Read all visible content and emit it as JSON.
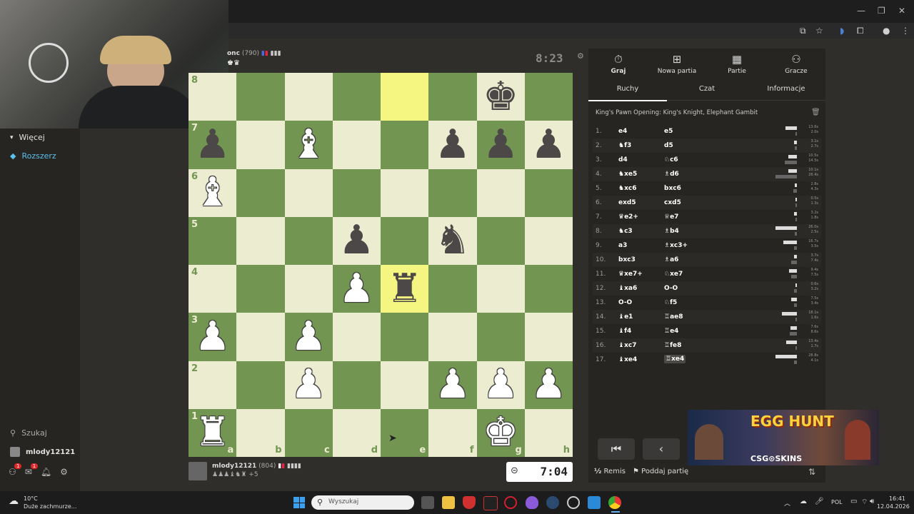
{
  "sidebar": {
    "more_label": "Więcej",
    "extend_label": "Rozszerz",
    "search_label": "Szukaj",
    "username": "mlody12121",
    "notif_badge_1": "1",
    "notif_badge_2": "1"
  },
  "opponent": {
    "name": "onc",
    "rating": "(790)",
    "clock": "8:23"
  },
  "player": {
    "name": "mlody12121",
    "rating": "(804)",
    "captured_advantage": "+5",
    "clock": "7:04"
  },
  "board": {
    "ranks": [
      "8",
      "7",
      "6",
      "5",
      "4",
      "3",
      "2",
      "1"
    ],
    "files": [
      "a",
      "b",
      "c",
      "d",
      "e",
      "f",
      "g",
      "h"
    ],
    "pieces": [
      [
        "",
        "",
        "",
        "",
        "",
        "",
        "♚",
        ""
      ],
      [
        "♟",
        "",
        "♝",
        "",
        "",
        "♟",
        "♟",
        "♟"
      ],
      [
        "♝",
        "",
        "",
        "",
        "",
        "",
        "",
        ""
      ],
      [
        "",
        "",
        "",
        "♟",
        "",
        "♞",
        "",
        ""
      ],
      [
        "",
        "",
        "",
        "♟",
        "♜",
        "",
        "",
        ""
      ],
      [
        "♟",
        "",
        "♟",
        "",
        "",
        "",
        "",
        ""
      ],
      [
        "",
        "",
        "♟",
        "",
        "",
        "♟",
        "♟",
        "♟"
      ],
      [
        "♜",
        "",
        "",
        "",
        "",
        "",
        "♚",
        ""
      ]
    ],
    "colors": [
      [
        "",
        "",
        "",
        "",
        "",
        "",
        "b",
        ""
      ],
      [
        "b",
        "",
        "w",
        "",
        "",
        "b",
        "b",
        "b"
      ],
      [
        "w",
        "",
        "",
        "",
        "",
        "",
        "",
        ""
      ],
      [
        "",
        "",
        "",
        "b",
        "",
        "b",
        "",
        ""
      ],
      [
        "",
        "",
        "",
        "w",
        "b",
        "",
        "",
        ""
      ],
      [
        "w",
        "",
        "w",
        "",
        "",
        "",
        "",
        ""
      ],
      [
        "",
        "",
        "w",
        "",
        "",
        "w",
        "w",
        "w"
      ],
      [
        "w",
        "",
        "",
        "",
        "",
        "",
        "w",
        ""
      ]
    ],
    "highlight": [
      [
        0,
        4
      ],
      [
        4,
        4
      ]
    ]
  },
  "nav_tabs": [
    {
      "label": "Graj",
      "icon": "clock-icon"
    },
    {
      "label": "Nowa partia",
      "icon": "plus-icon"
    },
    {
      "label": "Partie",
      "icon": "board-icon"
    },
    {
      "label": "Gracze",
      "icon": "players-icon"
    }
  ],
  "sub_tabs": [
    "Ruchy",
    "Czat",
    "Informacje"
  ],
  "opening": "King's Pawn Opening: King's Knight, Elephant Gambit",
  "moves": [
    {
      "n": "1.",
      "w": "e4",
      "b": "e5",
      "tw": "13.6s",
      "tb": "2.0s",
      "bw": 0.52,
      "bb": 0.08
    },
    {
      "n": "2.",
      "w": "♞f3",
      "b": "d5",
      "tw": "3.1s",
      "tb": "2.7s",
      "bw": 0.12,
      "bb": 0.1
    },
    {
      "n": "3.",
      "w": "d4",
      "b": "♘c6",
      "tw": "10.5s",
      "tb": "14.5s",
      "bw": 0.4,
      "bb": 0.56
    },
    {
      "n": "4.",
      "w": "♞xe5",
      "b": "♗d6",
      "tw": "10.1s",
      "tb": "26.4s",
      "bw": 0.39,
      "bb": 1.0
    },
    {
      "n": "5.",
      "w": "♞xc6",
      "b": "bxc6",
      "tw": "2.8s",
      "tb": "4.3s",
      "bw": 0.1,
      "bb": 0.16
    },
    {
      "n": "6.",
      "w": "exd5",
      "b": "cxd5",
      "tw": "0.5s",
      "tb": "1.3s",
      "bw": 0.02,
      "bb": 0.05
    },
    {
      "n": "7.",
      "w": "♛e2+",
      "b": "♕e7",
      "tw": "3.2s",
      "tb": "1.8s",
      "bw": 0.12,
      "bb": 0.07
    },
    {
      "n": "8.",
      "w": "♞c3",
      "b": "♗b4",
      "tw": "26.0s",
      "tb": "2.5s",
      "bw": 1.0,
      "bb": 0.09
    },
    {
      "n": "9.",
      "w": "a3",
      "b": "♗xc3+",
      "tw": "16.7s",
      "tb": "3.5s",
      "bw": 0.64,
      "bb": 0.13
    },
    {
      "n": "10.",
      "w": "bxc3",
      "b": "♗a6",
      "tw": "3.7s",
      "tb": "7.4s",
      "bw": 0.14,
      "bb": 0.28
    },
    {
      "n": "11.",
      "w": "♛xe7+",
      "b": "♘xe7",
      "tw": "9.4s",
      "tb": "7.5s",
      "bw": 0.36,
      "bb": 0.28
    },
    {
      "n": "12.",
      "w": "♝xa6",
      "b": "O-O",
      "tw": "0.6s",
      "tb": "3.2s",
      "bw": 0.02,
      "bb": 0.12
    },
    {
      "n": "13.",
      "w": "O-O",
      "b": "♘f5",
      "tw": "7.5s",
      "tb": "3.4s",
      "bw": 0.28,
      "bb": 0.13
    },
    {
      "n": "14.",
      "w": "♝e1",
      "b": "♖ae8",
      "tw": "18.1s",
      "tb": "1.6s",
      "bw": 0.69,
      "bb": 0.06
    },
    {
      "n": "15.",
      "w": "♝f4",
      "b": "♖e4",
      "tw": "7.6s",
      "tb": "8.6s",
      "bw": 0.29,
      "bb": 0.33
    },
    {
      "n": "16.",
      "w": "♝xc7",
      "b": "♖fe8",
      "tw": "13.4s",
      "tb": "1.7s",
      "bw": 0.51,
      "bb": 0.06
    },
    {
      "n": "17.",
      "w": "♝xe4",
      "b": "♖xe4",
      "tw": "28.8s",
      "tb": "4.1s",
      "bw": 1.0,
      "bb": 0.15
    }
  ],
  "actions": {
    "draw": "Remis",
    "resign": "Poddaj partię"
  },
  "ad": {
    "title": "EGG HUNT",
    "brand": "CSG⊙SKINS"
  },
  "weather": {
    "temp": "10°C",
    "desc": "Duże zachmurze..."
  },
  "taskbar": {
    "search_placeholder": "Wyszukaj",
    "lang": "POL",
    "time": "16:41",
    "date": "12.04.2026"
  }
}
